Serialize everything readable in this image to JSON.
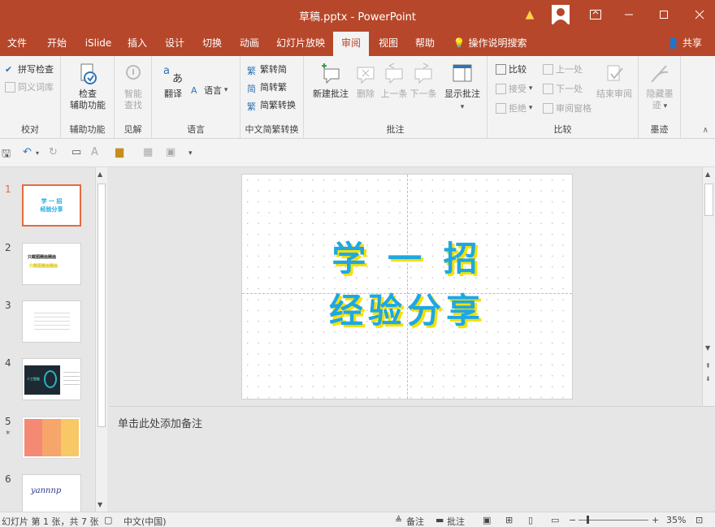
{
  "window": {
    "title": "草稿.pptx  -  PowerPoint",
    "icons": [
      "warning-icon",
      "user-avatar-icon",
      "ribbon-display-icon",
      "minimize-icon",
      "maximize-icon",
      "close-icon"
    ]
  },
  "tabs": [
    {
      "label": "文件"
    },
    {
      "label": "开始"
    },
    {
      "label": "iSlide"
    },
    {
      "label": "插入"
    },
    {
      "label": "设计"
    },
    {
      "label": "切换"
    },
    {
      "label": "动画"
    },
    {
      "label": "幻灯片放映"
    },
    {
      "label": "审阅"
    },
    {
      "label": "视图"
    },
    {
      "label": "帮助"
    },
    {
      "label": "操作说明搜索"
    }
  ],
  "share_label": "共享",
  "ribbon": {
    "proofing": {
      "spell": "拼写检查",
      "thesaurus": "同义词库",
      "label": "校对"
    },
    "accessibility": {
      "check_l1": "检查",
      "check_l2": "辅助功能",
      "label": "辅助功能"
    },
    "insights": {
      "smart_l1": "智能",
      "smart_l2": "查找",
      "label": "见解"
    },
    "language": {
      "translate": "翻译",
      "language": "语言",
      "label": "语言"
    },
    "chinese": {
      "to_simplified": "繁转简",
      "to_traditional": "简转繁",
      "convert": "简繁转换",
      "label": "中文简繁转换"
    },
    "comments": {
      "new": "新建批注",
      "delete": "删除",
      "prev": "上一条",
      "next": "下一条",
      "show": "显示批注",
      "label": "批注"
    },
    "compare": {
      "compare": "比较",
      "accept": "接受",
      "reject": "拒绝",
      "prev": "上一处",
      "next": "下一处",
      "pane": "审阅窗格",
      "end": "结束审阅",
      "label": "比较"
    },
    "ink": {
      "hide_l1": "隐藏墨",
      "hide_l2": "迹",
      "label": "墨迹"
    }
  },
  "thumbnails": [
    {
      "num": "1",
      "l1": "学  一  招",
      "l2": "经验分享"
    },
    {
      "num": "2",
      "l1": "只截图圈画圈画",
      "l2": "只截图圈画圈画"
    },
    {
      "num": "3"
    },
    {
      "num": "4",
      "l1": "人工智能"
    },
    {
      "num": "5",
      "star": "*"
    },
    {
      "num": "6",
      "l1": "yannnp"
    }
  ],
  "slide": {
    "line1": "学  一  招",
    "line2": "经验分享"
  },
  "notes_placeholder": "单击此处添加备注",
  "status": {
    "slide_info": "幻灯片 第 1 张，共 7 张",
    "language": "中文(中国)",
    "notes": "备注",
    "comments": "批注",
    "zoom": "35%"
  }
}
